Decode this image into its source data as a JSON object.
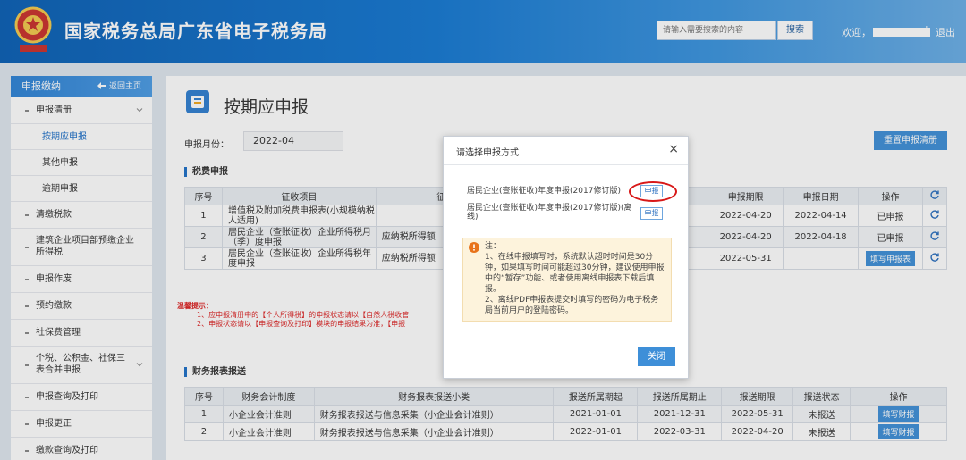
{
  "header": {
    "site_title": "国家税务总局广东省电子税务局",
    "search_placeholder": "请输入需要搜索的内容",
    "search_button": "搜索",
    "welcome": "欢迎，",
    "separator": "|",
    "logout": "退出"
  },
  "sidebar": {
    "head": "申报缴纳",
    "back_home": "返回主页",
    "items": [
      {
        "label": "申报清册"
      },
      {
        "label": "按期应申报"
      },
      {
        "label": "其他申报"
      },
      {
        "label": "逾期申报"
      },
      {
        "label": "清缴税款"
      },
      {
        "label": "建筑企业项目部预缴企业所得税"
      },
      {
        "label": "申报作废"
      },
      {
        "label": "预约缴款"
      },
      {
        "label": "社保费管理"
      },
      {
        "label": "个税、公积金、社保三表合并申报"
      },
      {
        "label": "申报查询及打印"
      },
      {
        "label": "申报更正"
      },
      {
        "label": "缴款查询及打印"
      }
    ]
  },
  "main": {
    "title": "按期应申报",
    "month_label": "申报月份：",
    "month_value": "2022-04",
    "reset_button": "重置申报清册",
    "tax_section": "税费申报",
    "tax_headers": [
      "序号",
      "征收项目",
      "征",
      "申报期限",
      "申报日期",
      "操作"
    ],
    "tax_rows": [
      {
        "no": "1",
        "item": "增值税及附加税费申报表(小规模纳税人适用)",
        "sub": "",
        "deadline": "2022-04-20",
        "date": "2022-04-14",
        "op": "已申报"
      },
      {
        "no": "2",
        "item": "居民企业（查账征收）企业所得税月（季）度申报",
        "sub": "应纳税所得额",
        "deadline": "2022-04-20",
        "date": "2022-04-18",
        "op": "已申报"
      },
      {
        "no": "3",
        "item": "居民企业（查账征收）企业所得税年度申报",
        "sub": "应纳税所得额",
        "deadline": "2022-05-31",
        "date": "",
        "op": "填写申报表"
      }
    ],
    "tip_head": "温馨提示：",
    "tip_lines": [
      "1、应申报清册中的【个人所得税】的申报状态请以【自然人税收管",
      "2、申报状态请以【申报查询及打印】模块的申报结果为准，【申报"
    ],
    "fin_section": "财务报表报送",
    "fin_headers": [
      "序号",
      "财务会计制度",
      "财务报表报送小类",
      "报送所属期起",
      "报送所属期止",
      "报送期限",
      "报送状态",
      "操作"
    ],
    "fin_rows": [
      {
        "no": "1",
        "system": "小企业会计准则",
        "type": "财务报表报送与信息采集（小企业会计准则）",
        "start": "2021-01-01",
        "end": "2021-12-31",
        "deadline": "2022-05-31",
        "status": "未报送",
        "op": "填写财报"
      },
      {
        "no": "2",
        "system": "小企业会计准则",
        "type": "财务报表报送与信息采集（小企业会计准则）",
        "start": "2022-01-01",
        "end": "2022-03-31",
        "deadline": "2022-04-20",
        "status": "未报送",
        "op": "填写财报"
      }
    ]
  },
  "dialog": {
    "title": "请选择申报方式",
    "close": "×",
    "option1": "居民企业(查账征收)年度申报(2017修订版)",
    "option1_btn": "申报",
    "option2": "居民企业(查账征收)年度申报(2017修订版)(离线)",
    "option2_btn": "申报",
    "notice_head": "注：",
    "notice_1": "1、在线申报填写时，系统默认超时时间是30分钟，如果填写时间可能超过30分钟，建议使用申报中的“暂存”功能、或者使用离线申报表下载后填报。",
    "notice_2": "2、离线PDF申报表提交时填写的密码为电子税务局当前用户的登陆密码。",
    "ok": "关闭"
  },
  "colors": {
    "header_blue": "#1478d2",
    "accent": "#3e8fd8",
    "tip_red": "#d22222",
    "highlight_circle": "#d81818"
  }
}
